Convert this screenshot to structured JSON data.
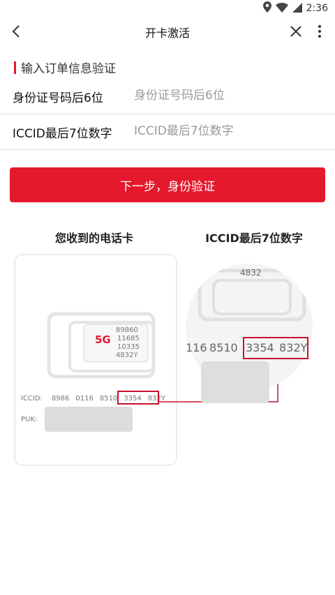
{
  "status_bar": {
    "time": "2:36"
  },
  "app_bar": {
    "title": "开卡激活"
  },
  "section": {
    "title": "输入订单信息验证"
  },
  "form": {
    "id_label": "身份证号码后6位",
    "id_placeholder": "身份证号码后6位",
    "iccid_label": "ICCID最后7位数字",
    "iccid_placeholder": "ICCID最后7位数字"
  },
  "next_button": {
    "label": "下一步，身份验证"
  },
  "illustration": {
    "left_heading": "您收到的电话卡",
    "right_heading": "ICCID最后7位数字",
    "sim": {
      "logo": "5G",
      "chip_lines": [
        "89860",
        "11685",
        "10335",
        "4832Y"
      ],
      "iccid_label": "ICCID:",
      "iccid_groups": [
        "8986",
        "0116",
        "8510",
        "3354",
        "832Y"
      ],
      "puk_label": "PUK:"
    },
    "zoom": {
      "top_number": "4832",
      "groups": [
        "116",
        "8510",
        "3354",
        "832Y"
      ]
    }
  },
  "colors": {
    "accent": "#e5192c",
    "highlight": "#c8102e"
  }
}
